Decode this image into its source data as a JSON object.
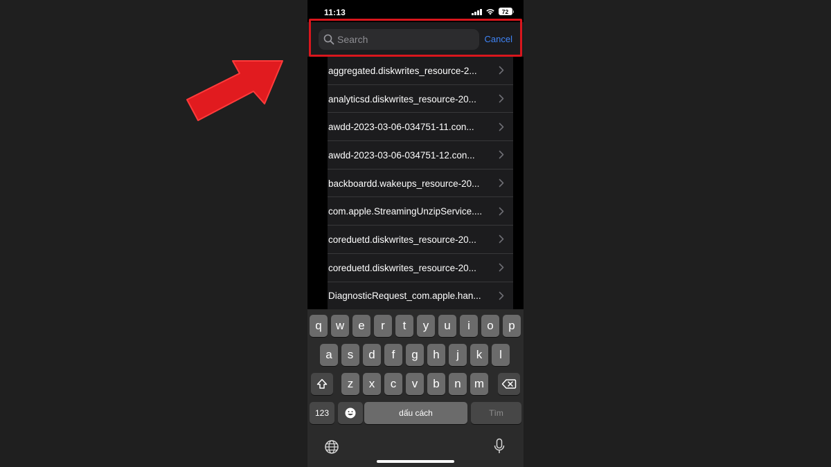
{
  "status_bar": {
    "time": "11:13",
    "battery": "72"
  },
  "search": {
    "placeholder": "Search",
    "value": "",
    "cancel_label": "Cancel"
  },
  "files": [
    "aggregated.diskwrites_resource-2...",
    "analyticsd.diskwrites_resource-20...",
    "awdd-2023-03-06-034751-11.con...",
    "awdd-2023-03-06-034751-12.con...",
    "backboardd.wakeups_resource-20...",
    "com.apple.StreamingUnzipService....",
    "coreduetd.diskwrites_resource-20...",
    "coreduetd.diskwrites_resource-20...",
    "DiagnosticRequest_com.apple.han..."
  ],
  "keyboard": {
    "row1": [
      "q",
      "w",
      "e",
      "r",
      "t",
      "y",
      "u",
      "i",
      "o",
      "p"
    ],
    "row2": [
      "a",
      "s",
      "d",
      "f",
      "g",
      "h",
      "j",
      "k",
      "l"
    ],
    "row3": [
      "z",
      "x",
      "c",
      "v",
      "b",
      "n",
      "m"
    ],
    "numbers_label": "123",
    "space_label": "dấu cách",
    "done_label": "Tìm"
  },
  "colors": {
    "accent": "#3f84f7",
    "highlight": "#d9161d",
    "background": "#1f1f1f"
  },
  "icons": {
    "search": "magnifier-icon",
    "chevron": "chevron-right-icon",
    "shift": "shift-arrow-icon",
    "delete": "backspace-icon",
    "emoji": "smiley-icon",
    "globe": "globe-icon",
    "mic": "microphone-icon"
  }
}
